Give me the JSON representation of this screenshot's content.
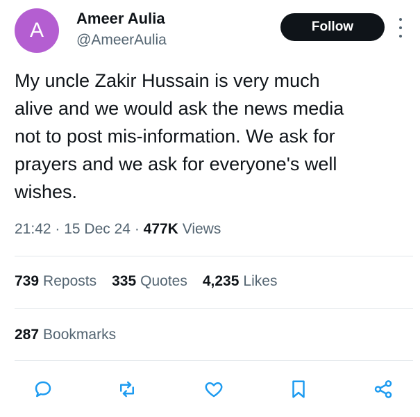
{
  "author": {
    "avatar_letter": "A",
    "name": "Ameer Aulia",
    "handle": "@AmeerAulia"
  },
  "follow_label": "Follow",
  "tweet": {
    "text": "My uncle Zakir Hussain is very much\nalive and we would ask the news media\nnot to post mis-information. We ask for\nprayers and we ask for everyone's well\nwishes."
  },
  "meta": {
    "time": "21:42",
    "date": "15 Dec 24",
    "views_count": "477K",
    "views_label": "Views"
  },
  "stats": {
    "reposts": {
      "count": "739",
      "label": "Reposts"
    },
    "quotes": {
      "count": "335",
      "label": "Quotes"
    },
    "likes": {
      "count": "4,235",
      "label": "Likes"
    },
    "bookmarks": {
      "count": "287",
      "label": "Bookmarks"
    }
  },
  "actions": [
    "reply-icon",
    "repost-icon",
    "like-icon",
    "bookmark-icon",
    "share-icon"
  ],
  "colors": {
    "avatar_bg": "#b45ed1",
    "icon": "#1d9bf0",
    "text_secondary": "#536471",
    "follow_bg": "#0f1419"
  }
}
